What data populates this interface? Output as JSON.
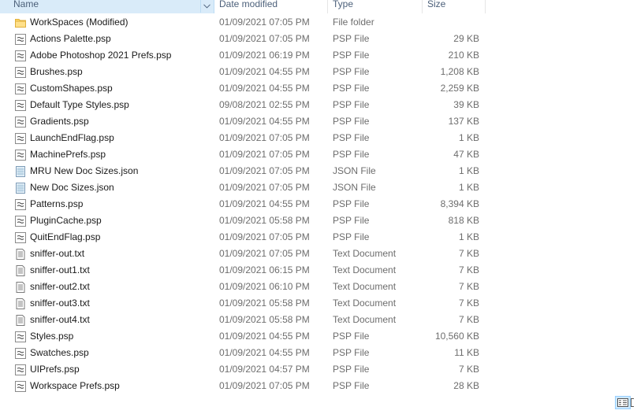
{
  "columns": {
    "name": "Name",
    "date": "Date modified",
    "type": "Type",
    "size": "Size"
  },
  "icons": {
    "folder": "folder-icon",
    "psp": "psp-file-icon",
    "json": "json-file-icon",
    "text": "text-file-icon",
    "sort": "chevron-down-icon"
  },
  "colors": {
    "header_selected": "#d9ebf9",
    "header_text": "#4c607a",
    "folder": "#ffd767",
    "muted_text": "#6d6d6d"
  },
  "files": [
    {
      "name": "WorkSpaces (Modified)",
      "date": "01/09/2021 07:05 PM",
      "type": "File folder",
      "size": "",
      "icon": "folder"
    },
    {
      "name": "Actions Palette.psp",
      "date": "01/09/2021 07:05 PM",
      "type": "PSP File",
      "size": "29 KB",
      "icon": "psp"
    },
    {
      "name": "Adobe Photoshop 2021 Prefs.psp",
      "date": "01/09/2021 06:19 PM",
      "type": "PSP File",
      "size": "210 KB",
      "icon": "psp"
    },
    {
      "name": "Brushes.psp",
      "date": "01/09/2021 04:55 PM",
      "type": "PSP File",
      "size": "1,208 KB",
      "icon": "psp"
    },
    {
      "name": "CustomShapes.psp",
      "date": "01/09/2021 04:55 PM",
      "type": "PSP File",
      "size": "2,259 KB",
      "icon": "psp"
    },
    {
      "name": "Default Type Styles.psp",
      "date": "09/08/2021 02:55 PM",
      "type": "PSP File",
      "size": "39 KB",
      "icon": "psp"
    },
    {
      "name": "Gradients.psp",
      "date": "01/09/2021 04:55 PM",
      "type": "PSP File",
      "size": "137 KB",
      "icon": "psp"
    },
    {
      "name": "LaunchEndFlag.psp",
      "date": "01/09/2021 07:05 PM",
      "type": "PSP File",
      "size": "1 KB",
      "icon": "psp"
    },
    {
      "name": "MachinePrefs.psp",
      "date": "01/09/2021 07:05 PM",
      "type": "PSP File",
      "size": "47 KB",
      "icon": "psp"
    },
    {
      "name": "MRU New Doc Sizes.json",
      "date": "01/09/2021 07:05 PM",
      "type": "JSON File",
      "size": "1 KB",
      "icon": "json"
    },
    {
      "name": "New Doc Sizes.json",
      "date": "01/09/2021 07:05 PM",
      "type": "JSON File",
      "size": "1 KB",
      "icon": "json"
    },
    {
      "name": "Patterns.psp",
      "date": "01/09/2021 04:55 PM",
      "type": "PSP File",
      "size": "8,394 KB",
      "icon": "psp"
    },
    {
      "name": "PluginCache.psp",
      "date": "01/09/2021 05:58 PM",
      "type": "PSP File",
      "size": "818 KB",
      "icon": "psp"
    },
    {
      "name": "QuitEndFlag.psp",
      "date": "01/09/2021 07:05 PM",
      "type": "PSP File",
      "size": "1 KB",
      "icon": "psp"
    },
    {
      "name": "sniffer-out.txt",
      "date": "01/09/2021 07:05 PM",
      "type": "Text Document",
      "size": "7 KB",
      "icon": "text"
    },
    {
      "name": "sniffer-out1.txt",
      "date": "01/09/2021 06:15 PM",
      "type": "Text Document",
      "size": "7 KB",
      "icon": "text"
    },
    {
      "name": "sniffer-out2.txt",
      "date": "01/09/2021 06:10 PM",
      "type": "Text Document",
      "size": "7 KB",
      "icon": "text"
    },
    {
      "name": "sniffer-out3.txt",
      "date": "01/09/2021 05:58 PM",
      "type": "Text Document",
      "size": "7 KB",
      "icon": "text"
    },
    {
      "name": "sniffer-out4.txt",
      "date": "01/09/2021 05:58 PM",
      "type": "Text Document",
      "size": "7 KB",
      "icon": "text"
    },
    {
      "name": "Styles.psp",
      "date": "01/09/2021 04:55 PM",
      "type": "PSP File",
      "size": "10,560 KB",
      "icon": "psp"
    },
    {
      "name": "Swatches.psp",
      "date": "01/09/2021 04:55 PM",
      "type": "PSP File",
      "size": "11 KB",
      "icon": "psp"
    },
    {
      "name": "UIPrefs.psp",
      "date": "01/09/2021 04:57 PM",
      "type": "PSP File",
      "size": "7 KB",
      "icon": "psp"
    },
    {
      "name": "Workspace Prefs.psp",
      "date": "01/09/2021 07:05 PM",
      "type": "PSP File",
      "size": "28 KB",
      "icon": "psp"
    }
  ],
  "view_toggles": [
    {
      "icon": "details-view-icon",
      "active": true
    },
    {
      "icon": "large-icons-view-icon",
      "active": false
    }
  ]
}
